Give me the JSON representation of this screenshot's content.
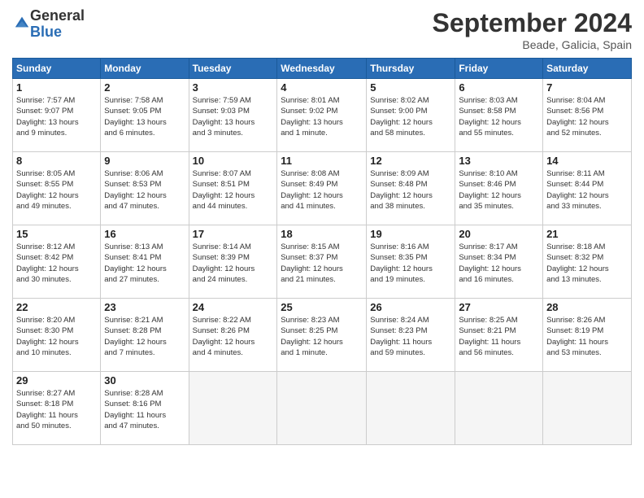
{
  "logo": {
    "general": "General",
    "blue": "Blue"
  },
  "title": "September 2024",
  "subtitle": "Beade, Galicia, Spain",
  "days_header": [
    "Sunday",
    "Monday",
    "Tuesday",
    "Wednesday",
    "Thursday",
    "Friday",
    "Saturday"
  ],
  "weeks": [
    [
      {
        "day": "1",
        "info": "Sunrise: 7:57 AM\nSunset: 9:07 PM\nDaylight: 13 hours\nand 9 minutes."
      },
      {
        "day": "2",
        "info": "Sunrise: 7:58 AM\nSunset: 9:05 PM\nDaylight: 13 hours\nand 6 minutes."
      },
      {
        "day": "3",
        "info": "Sunrise: 7:59 AM\nSunset: 9:03 PM\nDaylight: 13 hours\nand 3 minutes."
      },
      {
        "day": "4",
        "info": "Sunrise: 8:01 AM\nSunset: 9:02 PM\nDaylight: 13 hours\nand 1 minute."
      },
      {
        "day": "5",
        "info": "Sunrise: 8:02 AM\nSunset: 9:00 PM\nDaylight: 12 hours\nand 58 minutes."
      },
      {
        "day": "6",
        "info": "Sunrise: 8:03 AM\nSunset: 8:58 PM\nDaylight: 12 hours\nand 55 minutes."
      },
      {
        "day": "7",
        "info": "Sunrise: 8:04 AM\nSunset: 8:56 PM\nDaylight: 12 hours\nand 52 minutes."
      }
    ],
    [
      {
        "day": "8",
        "info": "Sunrise: 8:05 AM\nSunset: 8:55 PM\nDaylight: 12 hours\nand 49 minutes."
      },
      {
        "day": "9",
        "info": "Sunrise: 8:06 AM\nSunset: 8:53 PM\nDaylight: 12 hours\nand 47 minutes."
      },
      {
        "day": "10",
        "info": "Sunrise: 8:07 AM\nSunset: 8:51 PM\nDaylight: 12 hours\nand 44 minutes."
      },
      {
        "day": "11",
        "info": "Sunrise: 8:08 AM\nSunset: 8:49 PM\nDaylight: 12 hours\nand 41 minutes."
      },
      {
        "day": "12",
        "info": "Sunrise: 8:09 AM\nSunset: 8:48 PM\nDaylight: 12 hours\nand 38 minutes."
      },
      {
        "day": "13",
        "info": "Sunrise: 8:10 AM\nSunset: 8:46 PM\nDaylight: 12 hours\nand 35 minutes."
      },
      {
        "day": "14",
        "info": "Sunrise: 8:11 AM\nSunset: 8:44 PM\nDaylight: 12 hours\nand 33 minutes."
      }
    ],
    [
      {
        "day": "15",
        "info": "Sunrise: 8:12 AM\nSunset: 8:42 PM\nDaylight: 12 hours\nand 30 minutes."
      },
      {
        "day": "16",
        "info": "Sunrise: 8:13 AM\nSunset: 8:41 PM\nDaylight: 12 hours\nand 27 minutes."
      },
      {
        "day": "17",
        "info": "Sunrise: 8:14 AM\nSunset: 8:39 PM\nDaylight: 12 hours\nand 24 minutes."
      },
      {
        "day": "18",
        "info": "Sunrise: 8:15 AM\nSunset: 8:37 PM\nDaylight: 12 hours\nand 21 minutes."
      },
      {
        "day": "19",
        "info": "Sunrise: 8:16 AM\nSunset: 8:35 PM\nDaylight: 12 hours\nand 19 minutes."
      },
      {
        "day": "20",
        "info": "Sunrise: 8:17 AM\nSunset: 8:34 PM\nDaylight: 12 hours\nand 16 minutes."
      },
      {
        "day": "21",
        "info": "Sunrise: 8:18 AM\nSunset: 8:32 PM\nDaylight: 12 hours\nand 13 minutes."
      }
    ],
    [
      {
        "day": "22",
        "info": "Sunrise: 8:20 AM\nSunset: 8:30 PM\nDaylight: 12 hours\nand 10 minutes."
      },
      {
        "day": "23",
        "info": "Sunrise: 8:21 AM\nSunset: 8:28 PM\nDaylight: 12 hours\nand 7 minutes."
      },
      {
        "day": "24",
        "info": "Sunrise: 8:22 AM\nSunset: 8:26 PM\nDaylight: 12 hours\nand 4 minutes."
      },
      {
        "day": "25",
        "info": "Sunrise: 8:23 AM\nSunset: 8:25 PM\nDaylight: 12 hours\nand 1 minute."
      },
      {
        "day": "26",
        "info": "Sunrise: 8:24 AM\nSunset: 8:23 PM\nDaylight: 11 hours\nand 59 minutes."
      },
      {
        "day": "27",
        "info": "Sunrise: 8:25 AM\nSunset: 8:21 PM\nDaylight: 11 hours\nand 56 minutes."
      },
      {
        "day": "28",
        "info": "Sunrise: 8:26 AM\nSunset: 8:19 PM\nDaylight: 11 hours\nand 53 minutes."
      }
    ],
    [
      {
        "day": "29",
        "info": "Sunrise: 8:27 AM\nSunset: 8:18 PM\nDaylight: 11 hours\nand 50 minutes."
      },
      {
        "day": "30",
        "info": "Sunrise: 8:28 AM\nSunset: 8:16 PM\nDaylight: 11 hours\nand 47 minutes."
      },
      null,
      null,
      null,
      null,
      null
    ]
  ]
}
